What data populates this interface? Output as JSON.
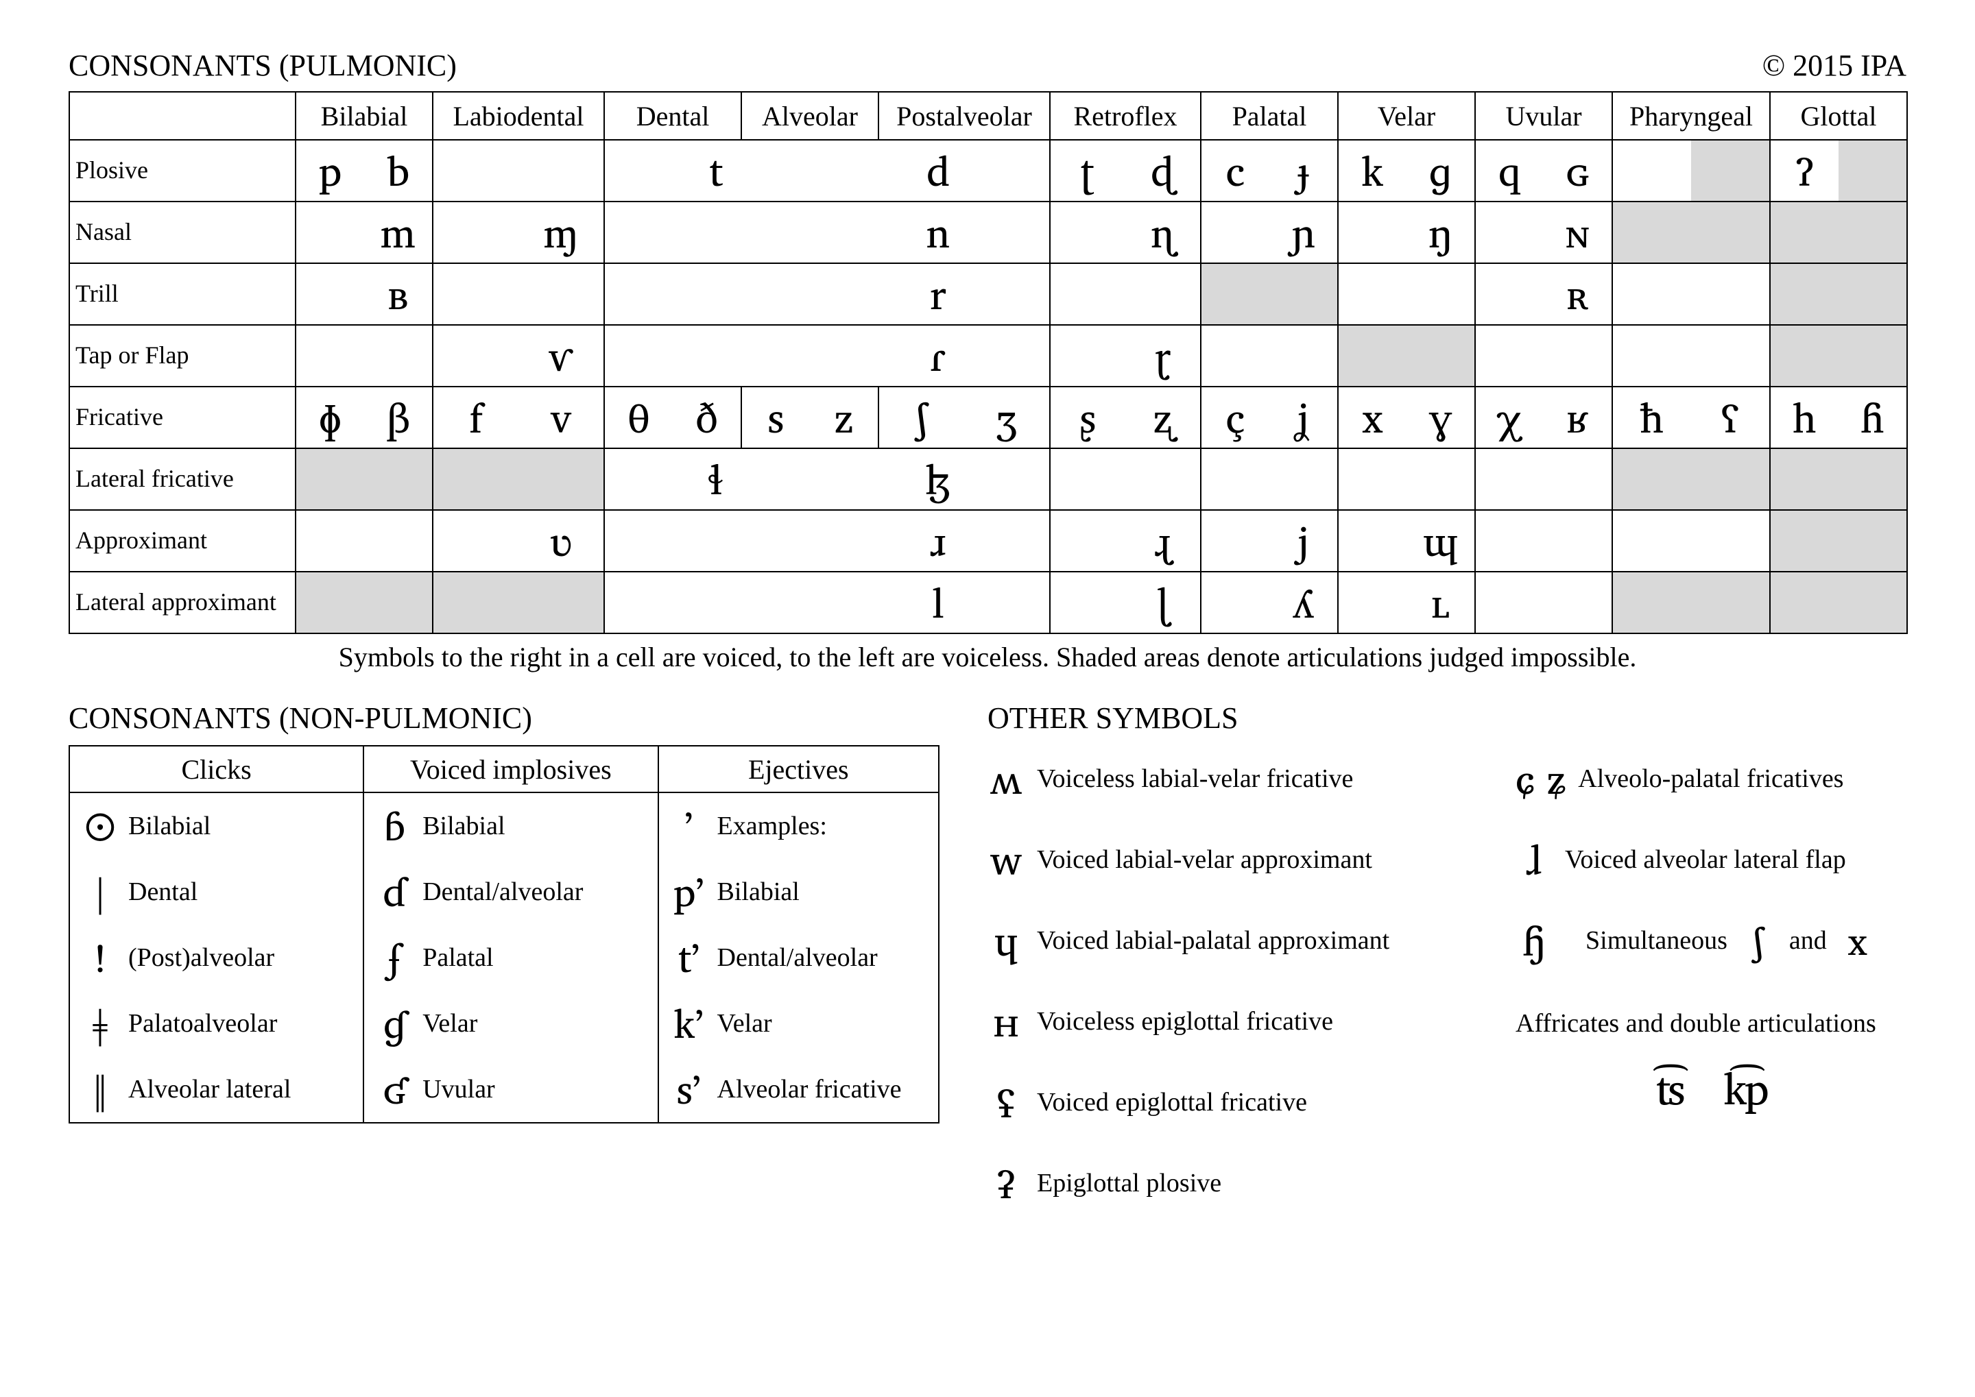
{
  "header": {
    "title": "CONSONANTS (PULMONIC)",
    "copyright": "© 2015 IPA"
  },
  "places": [
    "Bilabial",
    "Labiodental",
    "Dental",
    "Alveolar",
    "Postalveolar",
    "Retroflex",
    "Palatal",
    "Velar",
    "Uvular",
    "Pharyngeal",
    "Glottal"
  ],
  "rows": [
    {
      "name": "Plosive",
      "cells": [
        {
          "v0": "p",
          "v1": "b"
        },
        {
          "v0": "",
          "v1": ""
        },
        {
          "span": 3,
          "v0": "t",
          "v1": "d"
        },
        {
          "v0": "ʈ",
          "v1": "ɖ"
        },
        {
          "v0": "c",
          "v1": "ɟ"
        },
        {
          "v0": "k",
          "v1": "ɡ"
        },
        {
          "v0": "q",
          "v1": "ɢ"
        },
        {
          "v0": "",
          "v1": "",
          "imp": [
            false,
            true
          ]
        },
        {
          "v0": "ʔ",
          "v1": "",
          "imp": [
            false,
            true
          ]
        }
      ]
    },
    {
      "name": "Nasal",
      "cells": [
        {
          "v0": "",
          "v1": "m"
        },
        {
          "v0": "",
          "v1": "ɱ"
        },
        {
          "span": 3,
          "v0": "",
          "v1": "n"
        },
        {
          "v0": "",
          "v1": "ɳ"
        },
        {
          "v0": "",
          "v1": "ɲ"
        },
        {
          "v0": "",
          "v1": "ŋ"
        },
        {
          "v0": "",
          "v1": "ɴ"
        },
        {
          "imp": [
            true,
            true
          ]
        },
        {
          "imp": [
            true,
            true
          ]
        }
      ]
    },
    {
      "name": "Trill",
      "cells": [
        {
          "v0": "",
          "v1": "ʙ"
        },
        {
          "v0": "",
          "v1": ""
        },
        {
          "span": 3,
          "v0": "",
          "v1": "r"
        },
        {
          "v0": "",
          "v1": ""
        },
        {
          "imp": [
            true,
            true
          ]
        },
        {
          "v0": "",
          "v1": ""
        },
        {
          "v0": "",
          "v1": "ʀ"
        },
        {
          "v0": "",
          "v1": ""
        },
        {
          "imp": [
            true,
            true
          ]
        }
      ]
    },
    {
      "name": "Tap or Flap",
      "cells": [
        {
          "v0": "",
          "v1": ""
        },
        {
          "v0": "",
          "v1": "ⱱ"
        },
        {
          "span": 3,
          "v0": "",
          "v1": "ɾ"
        },
        {
          "v0": "",
          "v1": "ɽ"
        },
        {
          "v0": "",
          "v1": ""
        },
        {
          "imp": [
            true,
            true
          ]
        },
        {
          "v0": "",
          "v1": ""
        },
        {
          "v0": "",
          "v1": ""
        },
        {
          "imp": [
            true,
            true
          ]
        }
      ]
    },
    {
      "name": "Fricative",
      "cells": [
        {
          "v0": "ɸ",
          "v1": "β"
        },
        {
          "v0": "f",
          "v1": "v"
        },
        {
          "v0": "θ",
          "v1": "ð"
        },
        {
          "v0": "s",
          "v1": "z"
        },
        {
          "v0": "ʃ",
          "v1": "ʒ"
        },
        {
          "v0": "ʂ",
          "v1": "ʐ"
        },
        {
          "v0": "ç",
          "v1": "ʝ"
        },
        {
          "v0": "x",
          "v1": "ɣ"
        },
        {
          "v0": "χ",
          "v1": "ʁ"
        },
        {
          "v0": "ħ",
          "v1": "ʕ"
        },
        {
          "v0": "h",
          "v1": "ɦ"
        }
      ]
    },
    {
      "name": "Lateral fricative",
      "cells": [
        {
          "imp": [
            true,
            true
          ]
        },
        {
          "imp": [
            true,
            true
          ]
        },
        {
          "span": 3,
          "v0": "ɬ",
          "v1": "ɮ"
        },
        {
          "v0": "",
          "v1": ""
        },
        {
          "v0": "",
          "v1": ""
        },
        {
          "v0": "",
          "v1": ""
        },
        {
          "v0": "",
          "v1": ""
        },
        {
          "imp": [
            true,
            true
          ]
        },
        {
          "imp": [
            true,
            true
          ]
        }
      ]
    },
    {
      "name": "Approximant",
      "cells": [
        {
          "v0": "",
          "v1": ""
        },
        {
          "v0": "",
          "v1": "ʋ"
        },
        {
          "span": 3,
          "v0": "",
          "v1": "ɹ"
        },
        {
          "v0": "",
          "v1": "ɻ"
        },
        {
          "v0": "",
          "v1": "j"
        },
        {
          "v0": "",
          "v1": "ɰ"
        },
        {
          "v0": "",
          "v1": ""
        },
        {
          "v0": "",
          "v1": ""
        },
        {
          "imp": [
            true,
            true
          ]
        }
      ]
    },
    {
      "name": "Lateral approximant",
      "cells": [
        {
          "imp": [
            true,
            true
          ]
        },
        {
          "imp": [
            true,
            true
          ]
        },
        {
          "span": 3,
          "v0": "",
          "v1": "l"
        },
        {
          "v0": "",
          "v1": "ɭ"
        },
        {
          "v0": "",
          "v1": "ʎ"
        },
        {
          "v0": "",
          "v1": "ʟ"
        },
        {
          "v0": "",
          "v1": ""
        },
        {
          "imp": [
            true,
            true
          ]
        },
        {
          "imp": [
            true,
            true
          ]
        }
      ]
    }
  ],
  "note": "Symbols to the right in a cell are voiced, to the left are voiceless. Shaded areas denote articulations judged impossible.",
  "np": {
    "title": "CONSONANTS (NON-PULMONIC)",
    "headers": [
      "Clicks",
      "Voiced implosives",
      "Ejectives"
    ],
    "rows": [
      [
        {
          "s": "ʘ",
          "l": "Bilabial"
        },
        {
          "s": "ɓ",
          "l": "Bilabial"
        },
        {
          "s": "ʼ",
          "l": "Examples:"
        }
      ],
      [
        {
          "s": "ǀ",
          "l": "Dental"
        },
        {
          "s": "ɗ",
          "l": "Dental/alveolar"
        },
        {
          "s": "pʼ",
          "l": "Bilabial"
        }
      ],
      [
        {
          "s": "ǃ",
          "l": "(Post)alveolar"
        },
        {
          "s": "ʄ",
          "l": "Palatal"
        },
        {
          "s": "tʼ",
          "l": "Dental/alveolar"
        }
      ],
      [
        {
          "s": "ǂ",
          "l": "Palatoalveolar"
        },
        {
          "s": "ɠ",
          "l": "Velar"
        },
        {
          "s": "kʼ",
          "l": "Velar"
        }
      ],
      [
        {
          "s": "ǁ",
          "l": "Alveolar lateral"
        },
        {
          "s": "ʛ",
          "l": "Uvular"
        },
        {
          "s": "sʼ",
          "l": "Alveolar fricative"
        }
      ]
    ]
  },
  "other": {
    "title": "OTHER SYMBOLS",
    "left": [
      {
        "s": "ʍ",
        "l": "Voiceless labial-velar fricative"
      },
      {
        "s": "w",
        "l": "Voiced labial-velar approximant"
      },
      {
        "s": "ɥ",
        "l": "Voiced labial-palatal approximant"
      },
      {
        "s": "ʜ",
        "l": "Voiceless epiglottal fricative"
      },
      {
        "s": "ʢ",
        "l": "Voiced epiglottal fricative"
      },
      {
        "s": "ʡ",
        "l": "Epiglottal plosive"
      }
    ],
    "right": [
      {
        "s": "ɕ ʑ",
        "l": "Alveolo-palatal fricatives"
      },
      {
        "s": "ɺ",
        "l": "Voiced alveolar lateral flap"
      }
    ],
    "sim": {
      "s1": "ɧ",
      "pre": "Simultaneous",
      "s2": "ʃ",
      "mid": "and",
      "s3": "x"
    },
    "aff": {
      "l": "Affricates and double articulations",
      "ex1": "t͡s",
      "ex2": "k͡p"
    }
  }
}
